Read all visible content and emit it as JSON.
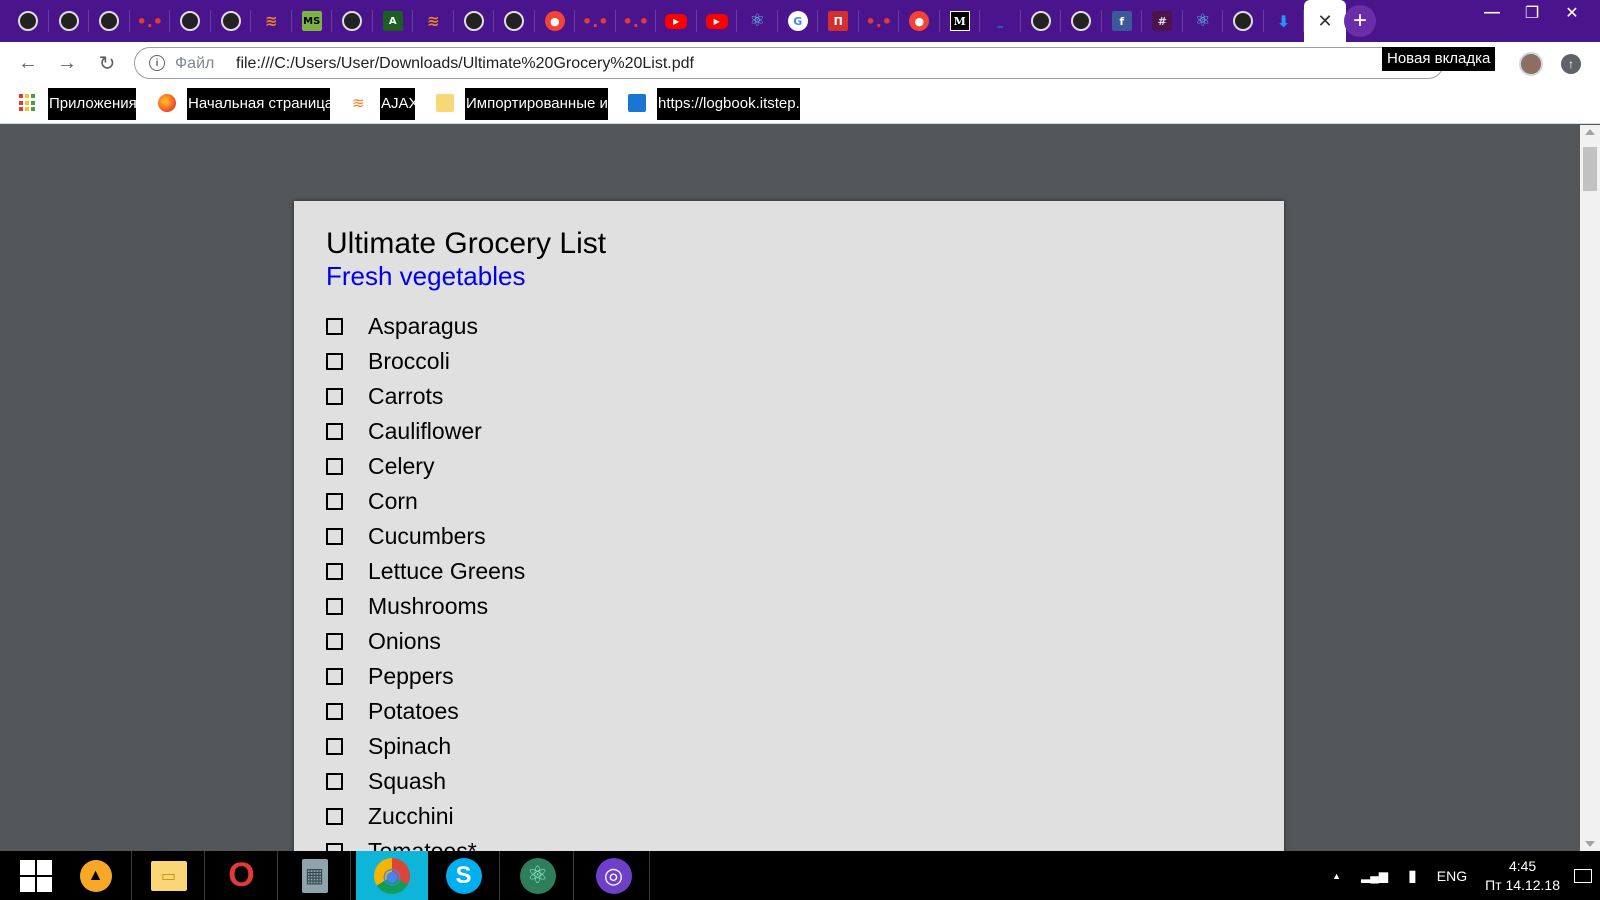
{
  "window": {
    "new_tab_label": "+",
    "minimize_label": "—",
    "maximize_label": "❐",
    "close_label": "✕"
  },
  "tabs": [
    {
      "icon": "github-icon",
      "glyph": ""
    },
    {
      "icon": "github-icon",
      "glyph": ""
    },
    {
      "icon": "github-icon",
      "glyph": ""
    },
    {
      "icon": "dots-icon",
      "glyph": "•.•"
    },
    {
      "icon": "github-icon",
      "glyph": ""
    },
    {
      "icon": "github-icon",
      "glyph": ""
    },
    {
      "icon": "stackoverflow-icon",
      "glyph": "≋"
    },
    {
      "icon": "ms-icon",
      "glyph": "MS"
    },
    {
      "icon": "github-icon",
      "glyph": ""
    },
    {
      "icon": "atom-icon",
      "glyph": "A"
    },
    {
      "icon": "stackoverflow-icon",
      "glyph": "≋"
    },
    {
      "icon": "github-icon",
      "glyph": ""
    },
    {
      "icon": "github-icon",
      "glyph": ""
    },
    {
      "icon": "badge-icon",
      "glyph": "●"
    },
    {
      "icon": "dots-icon",
      "glyph": "•.•"
    },
    {
      "icon": "dots-icon",
      "glyph": "•.•"
    },
    {
      "icon": "youtube-icon",
      "glyph": "▶"
    },
    {
      "icon": "youtube-icon",
      "glyph": "▶"
    },
    {
      "icon": "react-icon",
      "glyph": "⚛"
    },
    {
      "icon": "google-icon",
      "glyph": "G"
    },
    {
      "icon": "n-icon",
      "glyph": "П"
    },
    {
      "icon": "dots-icon",
      "glyph": "•.•"
    },
    {
      "icon": "badge-icon",
      "glyph": "●"
    },
    {
      "icon": "medium-icon",
      "glyph": "M"
    },
    {
      "icon": "line-icon",
      "glyph": "_"
    },
    {
      "icon": "github-icon",
      "glyph": ""
    },
    {
      "icon": "github-icon",
      "glyph": ""
    },
    {
      "icon": "facebook-icon",
      "glyph": "f"
    },
    {
      "icon": "hash-icon",
      "glyph": "#"
    },
    {
      "icon": "react-icon",
      "glyph": "⚛"
    },
    {
      "icon": "github-icon",
      "glyph": ""
    },
    {
      "icon": "download-icon",
      "glyph": "⬇"
    }
  ],
  "active_tab": {
    "close_label": "✕"
  },
  "toolbar": {
    "back_label": "←",
    "forward_label": "→",
    "reload_label": "↻",
    "scheme": "Файл",
    "url": "file:///C:/Users/User/Downloads/Ultimate%20Grocery%20List.pdf",
    "tooltip": "Новая вкладка"
  },
  "bookmarks": [
    {
      "icon": "apps-icon",
      "label": "Приложения"
    },
    {
      "icon": "firefox-icon",
      "label": "Начальная страница"
    },
    {
      "icon": "stackoverflow-icon",
      "label": "AJAX"
    },
    {
      "icon": "folder-icon",
      "label": "Импортированные из"
    },
    {
      "icon": "book-icon",
      "label": "https://logbook.itstep.org"
    }
  ],
  "document": {
    "title": "Ultimate Grocery List",
    "section": "Fresh vegetables",
    "items": [
      "Asparagus",
      "Broccoli",
      "Carrots",
      "Cauliflower",
      "Celery",
      "Corn",
      "Cucumbers",
      "Lettuce Greens",
      "Mushrooms",
      "Onions",
      "Peppers",
      "Potatoes",
      "Spinach",
      "Squash",
      "Zucchini",
      "Tomatoes*"
    ]
  },
  "taskbar": {
    "apps": [
      {
        "name": "start-icon"
      },
      {
        "name": "aimp-icon",
        "glyph": "▲"
      },
      {
        "name": "file-explorer-icon",
        "glyph": "▭"
      },
      {
        "name": "opera-icon",
        "glyph": "O"
      },
      {
        "name": "calculator-icon",
        "glyph": "▦"
      },
      {
        "name": "chrome-icon",
        "glyph": "◉"
      },
      {
        "name": "skype-icon",
        "glyph": "S"
      },
      {
        "name": "atom-icon",
        "glyph": "⚛"
      },
      {
        "name": "github-desktop-icon",
        "glyph": "◎"
      }
    ],
    "tray": {
      "arrow": "▲",
      "signal": "▂▄▆",
      "battery": "▮",
      "language": "ENG",
      "time": "4:45",
      "date": "Пт 14.12.18"
    }
  },
  "colors": {
    "tabstrip": "#4a148c",
    "pdf_background": "#525659",
    "page": "#e0e0e0",
    "section_heading": "#0000ee",
    "taskbar": "#000000",
    "taskbar_active": "#0fb5d8"
  }
}
